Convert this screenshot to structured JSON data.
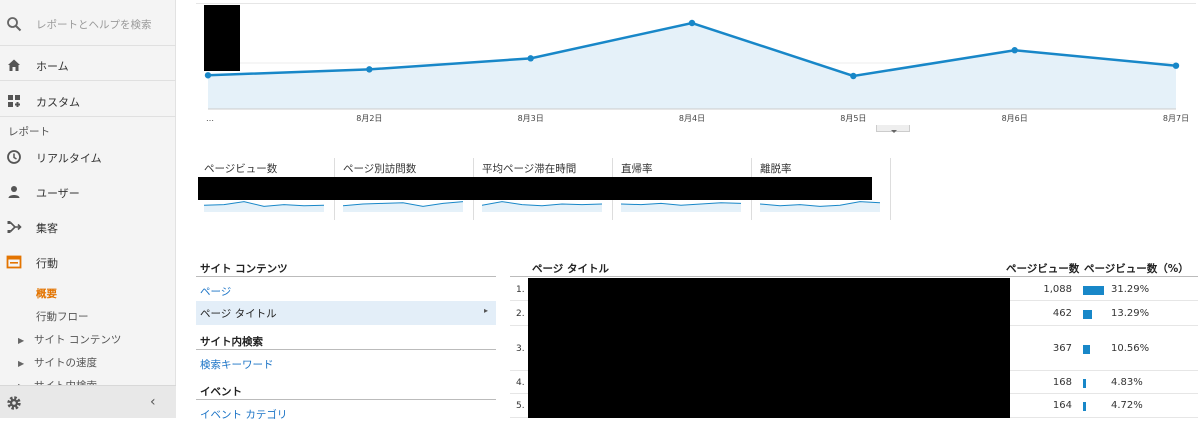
{
  "sidebar": {
    "search_placeholder": "レポートとヘルプを検索",
    "items": [
      {
        "label": "ホーム",
        "icon": "home-icon"
      },
      {
        "label": "カスタム",
        "icon": "dashboard-add-icon"
      }
    ],
    "reports_heading": "レポート",
    "report_items": [
      {
        "label": "リアルタイム",
        "icon": "clock-icon"
      },
      {
        "label": "ユーザー",
        "icon": "person-icon"
      },
      {
        "label": "集客",
        "icon": "acquisition-icon"
      },
      {
        "label": "行動",
        "icon": "behavior-icon",
        "active": true
      }
    ],
    "behavior_sub": [
      {
        "label": "概要",
        "active": true
      },
      {
        "label": "行動フロー",
        "active": false
      }
    ],
    "behavior_tree": [
      {
        "label": "サイト コンテンツ"
      },
      {
        "label": "サイトの速度"
      },
      {
        "label": "サイト内検索"
      }
    ],
    "footer": {
      "settings_icon": "gear-icon",
      "collapse_icon": "chevron-left-icon",
      "collapse_glyph": "‹"
    }
  },
  "colors": {
    "accent_orange": "#e37400",
    "line_blue": "#1887c8",
    "fill_blue": "#e5f1f9",
    "link_blue": "#1a73c6"
  },
  "chart_data": {
    "type": "area",
    "x_labels": [
      "…",
      "8月2日",
      "8月3日",
      "8月4日",
      "8月5日",
      "8月6日",
      "8月7日"
    ],
    "series": [
      {
        "values": [
          0.29,
          0.37,
          0.52,
          1.0,
          0.28,
          0.63,
          0.42
        ]
      }
    ],
    "note_scale": "relative values; y-axis values are not visible"
  },
  "metrics": [
    {
      "label": "ページビュー数"
    },
    {
      "label": "ページ別訪問数"
    },
    {
      "label": "平均ページ滞在時間"
    },
    {
      "label": "直帰率"
    },
    {
      "label": "離脱率"
    }
  ],
  "site_panel": {
    "groups": [
      {
        "heading": "サイト コンテンツ",
        "links": [
          {
            "label": "ページ",
            "selected": false
          },
          {
            "label": "ページ タイトル",
            "selected": true
          }
        ]
      },
      {
        "heading": "サイト内検索",
        "links": [
          {
            "label": "検索キーワード",
            "selected": false
          }
        ]
      },
      {
        "heading": "イベント",
        "links": [
          {
            "label": "イベント カテゴリ",
            "selected": false
          }
        ]
      }
    ],
    "selected_chevron": "▸"
  },
  "table": {
    "headers": {
      "title": "ページ タイトル",
      "pageviews": "ページビュー数",
      "percent": "ページビュー数（%）"
    },
    "rows": [
      {
        "rank": "1.",
        "pageviews": "1,088",
        "percent": "31.29%",
        "fraction": 0.3129
      },
      {
        "rank": "2.",
        "pageviews": "462",
        "percent": "13.29%",
        "fraction": 0.1329
      },
      {
        "rank": "3.",
        "pageviews": "367",
        "percent": "10.56%",
        "fraction": 0.1056
      },
      {
        "rank": "4.",
        "pageviews": "168",
        "percent": "4.83%",
        "fraction": 0.0483
      },
      {
        "rank": "5.",
        "pageviews": "164",
        "percent": "4.72%",
        "fraction": 0.0472
      }
    ]
  }
}
